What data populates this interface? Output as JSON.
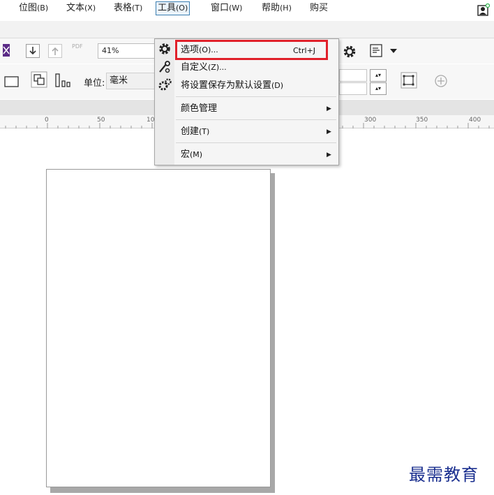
{
  "menubar": {
    "items": [
      {
        "label": "位图",
        "key": "(B)"
      },
      {
        "label": "文本",
        "key": "(X)"
      },
      {
        "label": "表格",
        "key": "(T)"
      },
      {
        "label": "工具",
        "key": "(O)"
      },
      {
        "label": "窗口",
        "key": "(W)"
      },
      {
        "label": "帮助",
        "key": "(H)"
      },
      {
        "label": "购买",
        "key": ""
      }
    ]
  },
  "toolbar": {
    "zoom_value": "41%",
    "pdf_label": "PDF"
  },
  "property_bar": {
    "unit_label": "单位:",
    "unit_value": "毫米"
  },
  "ruler": {
    "ticks": [
      "0",
      "50",
      "10",
      "300",
      "350",
      "400"
    ]
  },
  "tools_menu": {
    "items": [
      {
        "label": "选项",
        "key": "(O)...",
        "shortcut": "Ctrl+J"
      },
      {
        "label": "自定义",
        "key": "(Z)..."
      },
      {
        "label": "将设置保存为默认设置",
        "key": "(D)"
      },
      {
        "label": "颜色管理",
        "key": ""
      },
      {
        "label": "创建",
        "key": "(T)"
      },
      {
        "label": "宏",
        "key": "(M)"
      }
    ]
  },
  "icons": {
    "user": "user-account-icon",
    "options": "gear-icon",
    "customize": "wrench-icon",
    "save_defaults": "gears-icon",
    "submenu": "triangle-right-icon"
  },
  "colors": {
    "highlight_box": "#e0202a",
    "active_menu_border": "#3c7fb1",
    "watermark": "#1a2f8f"
  },
  "watermark": {
    "text": "最需教育"
  }
}
